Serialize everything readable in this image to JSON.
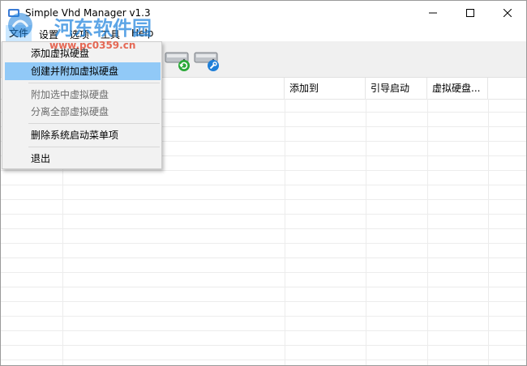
{
  "window": {
    "title": "Simple Vhd Manager v1.3",
    "minimize_glyph": "—",
    "maximize_glyph": "☐",
    "close_glyph": "✕"
  },
  "menubar": {
    "items": [
      {
        "label": "文件"
      },
      {
        "label": "设置"
      },
      {
        "label": "选项"
      },
      {
        "label": "工具"
      },
      {
        "label": "Help"
      }
    ]
  },
  "toolbar": {
    "buttons": [
      {
        "icon": "disk-refresh-icon"
      },
      {
        "icon": "disk-settings-icon"
      }
    ]
  },
  "listview": {
    "columns": [
      {
        "label": ""
      },
      {
        "label": ""
      },
      {
        "label": "添加到"
      },
      {
        "label": "引导启动"
      },
      {
        "label": "虚拟硬盘..."
      }
    ]
  },
  "context_menu": {
    "items": [
      {
        "label": "添加虚拟硬盘",
        "enabled": true,
        "highlighted": false
      },
      {
        "label": "创建并附加虚拟硬盘",
        "enabled": true,
        "highlighted": true
      },
      {
        "label": "附加选中虚拟硬盘",
        "enabled": false,
        "highlighted": false
      },
      {
        "label": "分离全部虚拟硬盘",
        "enabled": false,
        "highlighted": false
      },
      {
        "label": "删除系统启动菜单项",
        "enabled": true,
        "highlighted": false
      },
      {
        "label": "退出",
        "enabled": true,
        "highlighted": false
      }
    ]
  },
  "watermark": {
    "name": "河东软件园",
    "url": "www.pc0359.cn"
  },
  "colors": {
    "menu_highlight": "#91c9f7",
    "menu_open": "#cce8ff",
    "watermark_blue": "#1e82dc",
    "watermark_red": "#e14128"
  }
}
